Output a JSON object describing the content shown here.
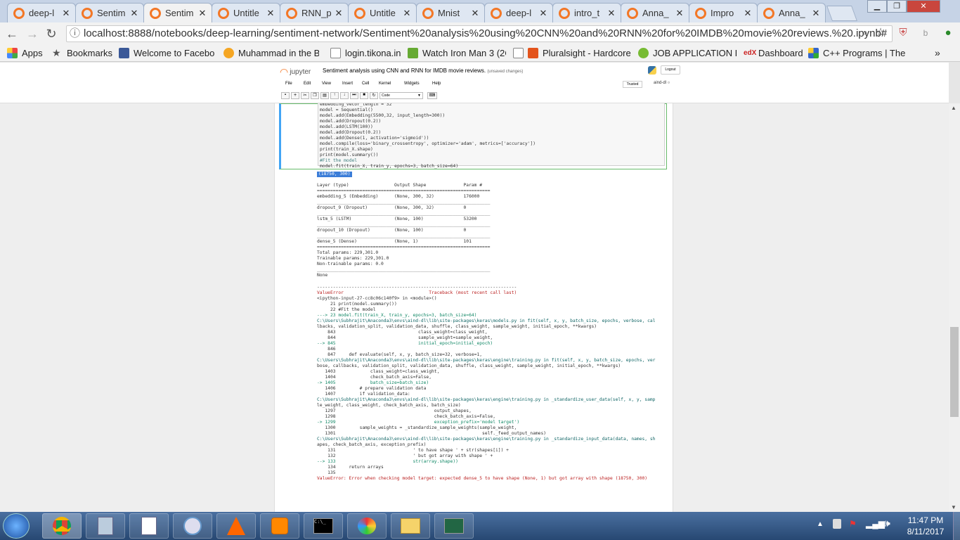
{
  "tabs": [
    "deep-l",
    "Sentim",
    "Sentim",
    "Untitle",
    "RNN_p",
    "Untitle",
    "Mnist",
    "deep-l",
    "intro_t",
    "Anna_",
    "Impro",
    "Anna_"
  ],
  "address": "localhost:8888/notebooks/deep-learning/sentiment-network/Sentiment%20analysis%20using%20CNN%20and%20RNN%20for%20IMDB%20movie%20reviews.%20.ipynb#",
  "bookmarks": [
    "Apps",
    "Bookmarks",
    "Welcome to Faceboo",
    "Muhammad in the Bi",
    "login.tikona.in",
    "Watch Iron Man 3 (2C",
    "Pluralsight - Hardcore",
    "JOB APPLICATION FC",
    "Dashboard",
    "C++ Programs | The"
  ],
  "jupyter": {
    "logo": "jupyter",
    "title": "Sentiment analysis using CNN and RNN for IMDB movie reviews.",
    "unsaved": "(unsaved changes)",
    "logout": "Logout",
    "trusted": "Trusted",
    "kernel": "aind-dl",
    "cell_type": "Code"
  },
  "menu": [
    "File",
    "Edit",
    "View",
    "Insert",
    "Cell",
    "Kernel",
    "Widgets",
    "Help"
  ],
  "code": [
    "embedding_vecor_length = 32",
    "model = Sequential()",
    "model.add(Embedding(5500,32, input_length=300))",
    "model.add(Dropout(0.2))",
    "model.add(LSTM(100))",
    "model.add(Dropout(0.2))",
    "model.add(Dense(1, activation='sigmoid'))",
    "model.compile(loss='binary_crossentropy', optimizer='adam', metrics=['accuracy'])",
    "print(train_X.shape)",
    "print(model.summary())",
    "#Fit the model",
    "model.fit(train_X, train_y, epochs=3, batch_size=64)"
  ],
  "shape_out": "(18750, 300)",
  "summary": [
    "Layer (type)                 Output Shape              Param #",
    "=================================================================",
    "embedding_5 (Embedding)      (None, 300, 32)           176000",
    "_________________________________________________________________",
    "dropout_9 (Dropout)          (None, 300, 32)           0",
    "_________________________________________________________________",
    "lstm_5 (LSTM)                (None, 100)               53200",
    "_________________________________________________________________",
    "dropout_10 (Dropout)         (None, 100)               0",
    "_________________________________________________________________",
    "dense_5 (Dense)              (None, 1)                 101",
    "=================================================================",
    "Total params: 229,301.0",
    "Trainable params: 229,301.0",
    "Non-trainable params: 0.0",
    "_________________________________________________________________",
    "None"
  ],
  "traceback": [
    "---------------------------------------------------------------------------",
    "ValueError                                Traceback (most recent call last)",
    "<ipython-input-27-cc8c06c140f9> in <module>()",
    "     21 print(model.summary())",
    "     22 #Fit the model",
    "---> 23 model.fit(train_X, train_y, epochs=3, batch_size=64)",
    "",
    "C:\\Users\\Subhrajit\\Anaconda3\\envs\\aind-dl\\lib\\site-packages\\keras\\models.py in fit(self, x, y, batch_size, epochs, verbose, cal",
    "lbacks, validation_split, validation_data, shuffle, class_weight, sample_weight, initial_epoch, **kwargs)",
    "    843                               class_weight=class_weight,",
    "    844                               sample_weight=sample_weight,",
    "--> 845                               initial_epoch=initial_epoch)",
    "    846 ",
    "    847     def evaluate(self, x, y, batch_size=32, verbose=1,",
    "",
    "C:\\Users\\Subhrajit\\Anaconda3\\envs\\aind-dl\\lib\\site-packages\\keras\\engine\\training.py in fit(self, x, y, batch_size, epochs, ver",
    "bose, callbacks, validation_split, validation_data, shuffle, class_weight, sample_weight, initial_epoch, **kwargs)",
    "   1403             class_weight=class_weight,",
    "   1404             check_batch_axis=False,",
    "-> 1405             batch_size=batch_size)",
    "   1406         # prepare validation data",
    "   1407         if validation_data:",
    "",
    "C:\\Users\\Subhrajit\\Anaconda3\\envs\\aind-dl\\lib\\site-packages\\keras\\engine\\training.py in _standardize_user_data(self, x, y, samp",
    "le_weight, class_weight, check_batch_axis, batch_size)",
    "   1297                                     output_shapes,",
    "   1298                                     check_batch_axis=False,",
    "-> 1299                                     exception_prefix='model target')",
    "   1300         sample_weights = _standardize_sample_weights(sample_weight,",
    "   1301                                                       self._feed_output_names)",
    "",
    "C:\\Users\\Subhrajit\\Anaconda3\\envs\\aind-dl\\lib\\site-packages\\keras\\engine\\training.py in _standardize_input_data(data, names, sh",
    "apes, check_batch_axis, exception_prefix)",
    "    131                             ' to have shape ' + str(shapes[i]) +",
    "    132                             ' but got array with shape ' +",
    "--> 133                             str(array.shape))",
    "    134     return arrays",
    "    135 ",
    "",
    "ValueError: Error when checking model target: expected dense_5 to have shape (None, 1) but got array with shape (18750, 300)"
  ],
  "clock": {
    "time": "11:47 PM",
    "date": "8/11/2017"
  }
}
